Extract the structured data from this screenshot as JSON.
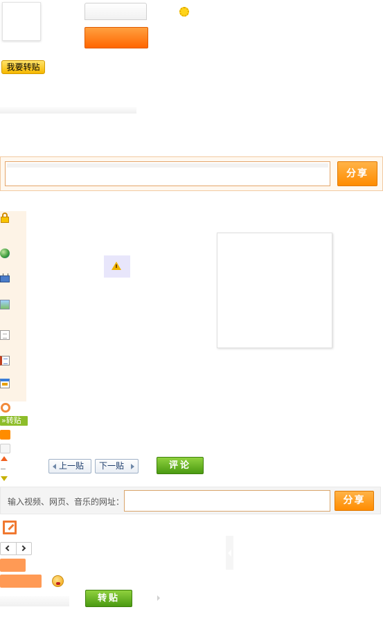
{
  "top": {
    "repost_label": "我要转贴"
  },
  "share_box": {
    "share_label": "分享"
  },
  "side": {
    "repost_tag": "»转贴"
  },
  "post_nav": {
    "prev_label": "上一贴",
    "next_label": "下一贴",
    "comment_label": "评论"
  },
  "url_share": {
    "label": "输入视频、网页、音乐的网址：",
    "share_label": "分享"
  },
  "bottom": {
    "repost_label": "转贴"
  },
  "icons": [
    "sun-icon",
    "lock-icon",
    "globe-icon",
    "tv-icon",
    "image-icon",
    "document-icon",
    "notebook-icon",
    "calendar-icon",
    "ring-icon",
    "arrow-up-icon",
    "arrow-down-icon",
    "warning-icon",
    "edit-icon",
    "chevron-left-icon",
    "chevron-right-icon",
    "face-icon"
  ],
  "colors": {
    "accent_orange": "#ff8c00",
    "accent_green": "#5aa81a",
    "panel_cream": "#fdf3e6"
  }
}
